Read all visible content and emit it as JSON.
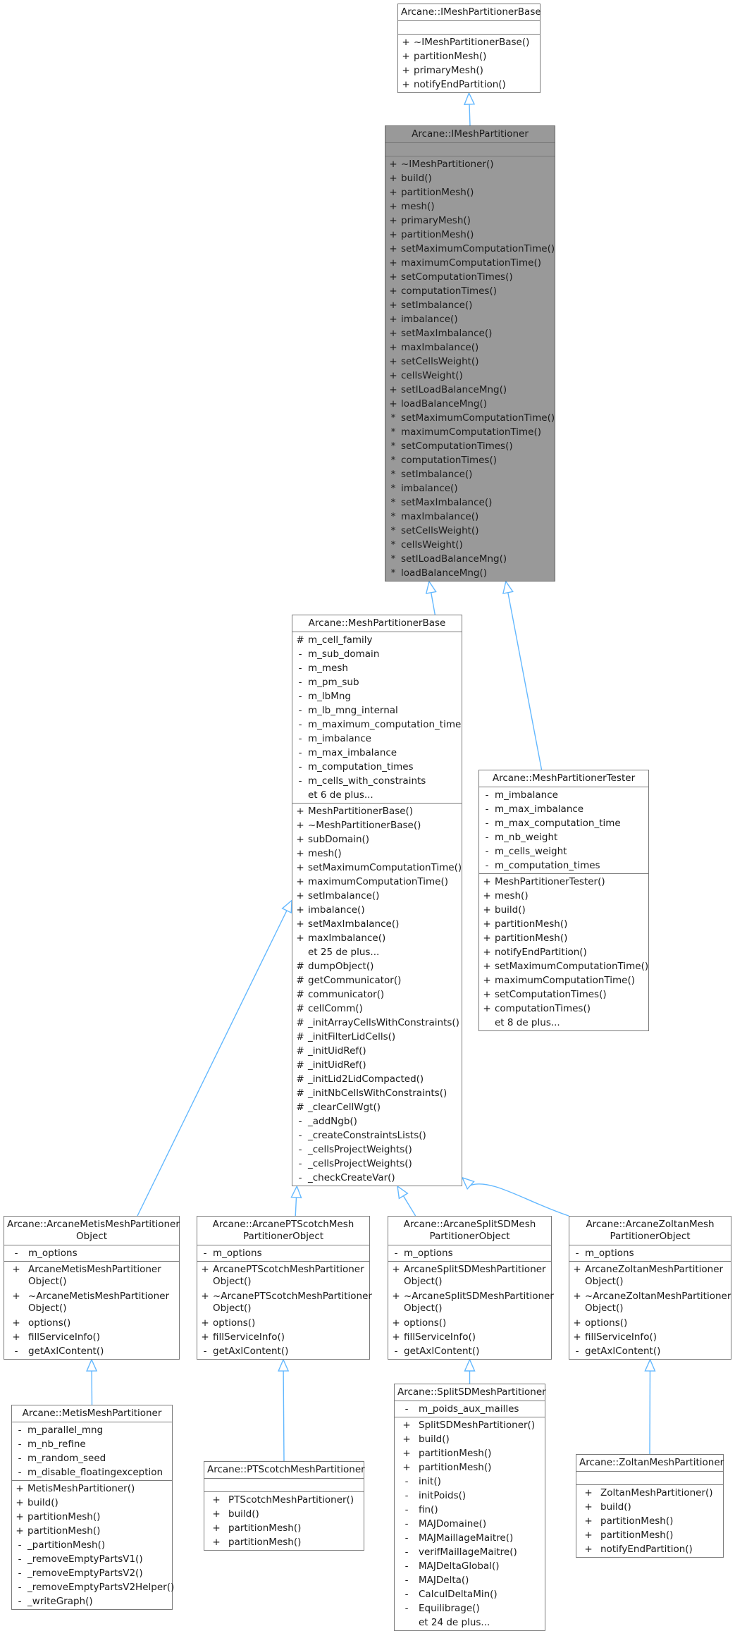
{
  "diagram": {
    "edge_color": "#63b8ff",
    "highlight_fill": "#999999",
    "nodes": [
      {
        "id": "IMeshPartitionerBase",
        "title": "Arcane::IMeshPartitionerBase",
        "attributes": [],
        "methods": [
          {
            "vis": "+",
            "name": "~IMeshPartitionerBase()"
          },
          {
            "vis": "+",
            "name": "partitionMesh()"
          },
          {
            "vis": "+",
            "name": "primaryMesh()"
          },
          {
            "vis": "+",
            "name": "notifyEndPartition()"
          }
        ]
      },
      {
        "id": "IMeshPartitioner",
        "title": "Arcane::IMeshPartitioner",
        "highlighted": true,
        "attributes": [],
        "methods": [
          {
            "vis": "+",
            "name": "~IMeshPartitioner()"
          },
          {
            "vis": "+",
            "name": "build()"
          },
          {
            "vis": "+",
            "name": "partitionMesh()"
          },
          {
            "vis": "+",
            "name": "mesh()"
          },
          {
            "vis": "+",
            "name": "primaryMesh()"
          },
          {
            "vis": "+",
            "name": "partitionMesh()"
          },
          {
            "vis": "+",
            "name": "setMaximumComputationTime()"
          },
          {
            "vis": "+",
            "name": "maximumComputationTime()"
          },
          {
            "vis": "+",
            "name": "setComputationTimes()"
          },
          {
            "vis": "+",
            "name": "computationTimes()"
          },
          {
            "vis": "+",
            "name": "setImbalance()"
          },
          {
            "vis": "+",
            "name": "imbalance()"
          },
          {
            "vis": "+",
            "name": "setMaxImbalance()"
          },
          {
            "vis": "+",
            "name": "maxImbalance()"
          },
          {
            "vis": "+",
            "name": "setCellsWeight()"
          },
          {
            "vis": "+",
            "name": "cellsWeight()"
          },
          {
            "vis": "+",
            "name": "setILoadBalanceMng()"
          },
          {
            "vis": "+",
            "name": "loadBalanceMng()"
          },
          {
            "vis": "*",
            "name": "setMaximumComputationTime()"
          },
          {
            "vis": "*",
            "name": "maximumComputationTime()"
          },
          {
            "vis": "*",
            "name": "setComputationTimes()"
          },
          {
            "vis": "*",
            "name": "computationTimes()"
          },
          {
            "vis": "*",
            "name": "setImbalance()"
          },
          {
            "vis": "*",
            "name": "imbalance()"
          },
          {
            "vis": "*",
            "name": "setMaxImbalance()"
          },
          {
            "vis": "*",
            "name": "maxImbalance()"
          },
          {
            "vis": "*",
            "name": "setCellsWeight()"
          },
          {
            "vis": "*",
            "name": "cellsWeight()"
          },
          {
            "vis": "*",
            "name": "setILoadBalanceMng()"
          },
          {
            "vis": "*",
            "name": "loadBalanceMng()"
          }
        ]
      },
      {
        "id": "MeshPartitionerBase",
        "title": "Arcane::MeshPartitionerBase",
        "attributes": [
          {
            "vis": "#",
            "name": "m_cell_family"
          },
          {
            "vis": "-",
            "name": "m_sub_domain"
          },
          {
            "vis": "-",
            "name": "m_mesh"
          },
          {
            "vis": "-",
            "name": "m_pm_sub"
          },
          {
            "vis": "-",
            "name": "m_lbMng"
          },
          {
            "vis": "-",
            "name": "m_lb_mng_internal"
          },
          {
            "vis": "-",
            "name": "m_maximum_computation_time"
          },
          {
            "vis": "-",
            "name": "m_imbalance"
          },
          {
            "vis": "-",
            "name": "m_max_imbalance"
          },
          {
            "vis": "-",
            "name": "m_computation_times"
          },
          {
            "vis": "-",
            "name": "m_cells_with_constraints"
          },
          {
            "vis": "",
            "name": "et 6 de plus..."
          }
        ],
        "methods": [
          {
            "vis": "+",
            "name": "MeshPartitionerBase()"
          },
          {
            "vis": "+",
            "name": "~MeshPartitionerBase()"
          },
          {
            "vis": "+",
            "name": "subDomain()"
          },
          {
            "vis": "+",
            "name": "mesh()"
          },
          {
            "vis": "+",
            "name": "setMaximumComputationTime()"
          },
          {
            "vis": "+",
            "name": "maximumComputationTime()"
          },
          {
            "vis": "+",
            "name": "setImbalance()"
          },
          {
            "vis": "+",
            "name": "imbalance()"
          },
          {
            "vis": "+",
            "name": "setMaxImbalance()"
          },
          {
            "vis": "+",
            "name": "maxImbalance()"
          },
          {
            "vis": "",
            "name": "et 25 de plus..."
          },
          {
            "vis": "#",
            "name": "dumpObject()"
          },
          {
            "vis": "#",
            "name": "getCommunicator()"
          },
          {
            "vis": "#",
            "name": "communicator()"
          },
          {
            "vis": "#",
            "name": "cellComm()"
          },
          {
            "vis": "#",
            "name": "_initArrayCellsWithConstraints()"
          },
          {
            "vis": "#",
            "name": "_initFilterLidCells()"
          },
          {
            "vis": "#",
            "name": "_initUidRef()"
          },
          {
            "vis": "#",
            "name": "_initUidRef()"
          },
          {
            "vis": "#",
            "name": "_initLid2LidCompacted()"
          },
          {
            "vis": "#",
            "name": "_initNbCellsWithConstraints()"
          },
          {
            "vis": "#",
            "name": "_clearCellWgt()"
          },
          {
            "vis": "-",
            "name": "_addNgb()"
          },
          {
            "vis": "-",
            "name": "_createConstraintsLists()"
          },
          {
            "vis": "-",
            "name": "_cellsProjectWeights()"
          },
          {
            "vis": "-",
            "name": "_cellsProjectWeights()"
          },
          {
            "vis": "-",
            "name": "_checkCreateVar()"
          }
        ]
      },
      {
        "id": "MeshPartitionerTester",
        "title": "Arcane::MeshPartitionerTester",
        "attributes": [
          {
            "vis": "-",
            "name": "m_imbalance"
          },
          {
            "vis": "-",
            "name": "m_max_imbalance"
          },
          {
            "vis": "-",
            "name": "m_max_computation_time"
          },
          {
            "vis": "-",
            "name": "m_nb_weight"
          },
          {
            "vis": "-",
            "name": "m_cells_weight"
          },
          {
            "vis": "-",
            "name": "m_computation_times"
          }
        ],
        "methods": [
          {
            "vis": "+",
            "name": "MeshPartitionerTester()"
          },
          {
            "vis": "+",
            "name": "mesh()"
          },
          {
            "vis": "+",
            "name": "build()"
          },
          {
            "vis": "+",
            "name": "partitionMesh()"
          },
          {
            "vis": "+",
            "name": "partitionMesh()"
          },
          {
            "vis": "+",
            "name": "notifyEndPartition()"
          },
          {
            "vis": "+",
            "name": "setMaximumComputationTime()"
          },
          {
            "vis": "+",
            "name": "maximumComputationTime()"
          },
          {
            "vis": "+",
            "name": "setComputationTimes()"
          },
          {
            "vis": "+",
            "name": "computationTimes()"
          },
          {
            "vis": "",
            "name": "et 8 de plus..."
          }
        ]
      },
      {
        "id": "ArcaneMetisMeshPartitionerObject",
        "title": "Arcane::ArcaneMetisMeshPartitioner\nObject",
        "attributes": [
          {
            "vis": "-",
            "name": "m_options"
          }
        ],
        "methods": [
          {
            "vis": "+",
            "name": "ArcaneMetisMeshPartitioner\nObject()"
          },
          {
            "vis": "+",
            "name": "~ArcaneMetisMeshPartitioner\nObject()"
          },
          {
            "vis": "+",
            "name": "options()"
          },
          {
            "vis": "+",
            "name": "fillServiceInfo()"
          },
          {
            "vis": "-",
            "name": "getAxlContent()"
          }
        ]
      },
      {
        "id": "ArcanePTScotchMeshPartitionerObject",
        "title": "Arcane::ArcanePTScotchMesh\nPartitionerObject",
        "attributes": [
          {
            "vis": "-",
            "name": "m_options"
          }
        ],
        "methods": [
          {
            "vis": "+",
            "name": "ArcanePTScotchMeshPartitioner\nObject()"
          },
          {
            "vis": "+",
            "name": "~ArcanePTScotchMeshPartitioner\nObject()"
          },
          {
            "vis": "+",
            "name": "options()"
          },
          {
            "vis": "+",
            "name": "fillServiceInfo()"
          },
          {
            "vis": "-",
            "name": "getAxlContent()"
          }
        ]
      },
      {
        "id": "ArcaneSplitSDMeshPartitionerObject",
        "title": "Arcane::ArcaneSplitSDMesh\nPartitionerObject",
        "attributes": [
          {
            "vis": "-",
            "name": "m_options"
          }
        ],
        "methods": [
          {
            "vis": "+",
            "name": "ArcaneSplitSDMeshPartitioner\nObject()"
          },
          {
            "vis": "+",
            "name": "~ArcaneSplitSDMeshPartitioner\nObject()"
          },
          {
            "vis": "+",
            "name": "options()"
          },
          {
            "vis": "+",
            "name": "fillServiceInfo()"
          },
          {
            "vis": "-",
            "name": "getAxlContent()"
          }
        ]
      },
      {
        "id": "ArcaneZoltanMeshPartitionerObject",
        "title": "Arcane::ArcaneZoltanMesh\nPartitionerObject",
        "attributes": [
          {
            "vis": "-",
            "name": "m_options"
          }
        ],
        "methods": [
          {
            "vis": "+",
            "name": "ArcaneZoltanMeshPartitioner\nObject()"
          },
          {
            "vis": "+",
            "name": "~ArcaneZoltanMeshPartitioner\nObject()"
          },
          {
            "vis": "+",
            "name": "options()"
          },
          {
            "vis": "+",
            "name": "fillServiceInfo()"
          },
          {
            "vis": "-",
            "name": "getAxlContent()"
          }
        ]
      },
      {
        "id": "MetisMeshPartitioner",
        "title": "Arcane::MetisMeshPartitioner",
        "attributes": [
          {
            "vis": "-",
            "name": "m_parallel_mng"
          },
          {
            "vis": "-",
            "name": "m_nb_refine"
          },
          {
            "vis": "-",
            "name": "m_random_seed"
          },
          {
            "vis": "-",
            "name": "m_disable_floatingexception"
          }
        ],
        "methods": [
          {
            "vis": "+",
            "name": "MetisMeshPartitioner()"
          },
          {
            "vis": "+",
            "name": "build()"
          },
          {
            "vis": "+",
            "name": "partitionMesh()"
          },
          {
            "vis": "+",
            "name": "partitionMesh()"
          },
          {
            "vis": "-",
            "name": "_partitionMesh()"
          },
          {
            "vis": "-",
            "name": "_removeEmptyPartsV1()"
          },
          {
            "vis": "-",
            "name": "_removeEmptyPartsV2()"
          },
          {
            "vis": "-",
            "name": "_removeEmptyPartsV2Helper()"
          },
          {
            "vis": "-",
            "name": "_writeGraph()"
          }
        ]
      },
      {
        "id": "PTScotchMeshPartitioner",
        "title": "Arcane::PTScotchMeshPartitioner",
        "attributes": [],
        "methods": [
          {
            "vis": "+",
            "name": "PTScotchMeshPartitioner()"
          },
          {
            "vis": "+",
            "name": "build()"
          },
          {
            "vis": "+",
            "name": "partitionMesh()"
          },
          {
            "vis": "+",
            "name": "partitionMesh()"
          }
        ]
      },
      {
        "id": "SplitSDMeshPartitioner",
        "title": "Arcane::SplitSDMeshPartitioner",
        "attributes": [
          {
            "vis": "-",
            "name": "m_poids_aux_mailles"
          }
        ],
        "methods": [
          {
            "vis": "+",
            "name": "SplitSDMeshPartitioner()"
          },
          {
            "vis": "+",
            "name": "build()"
          },
          {
            "vis": "+",
            "name": "partitionMesh()"
          },
          {
            "vis": "+",
            "name": "partitionMesh()"
          },
          {
            "vis": "-",
            "name": "init()"
          },
          {
            "vis": "-",
            "name": "initPoids()"
          },
          {
            "vis": "-",
            "name": "fin()"
          },
          {
            "vis": "-",
            "name": "MAJDomaine()"
          },
          {
            "vis": "-",
            "name": "MAJMaillageMaitre()"
          },
          {
            "vis": "-",
            "name": "verifMaillageMaitre()"
          },
          {
            "vis": "-",
            "name": "MAJDeltaGlobal()"
          },
          {
            "vis": "-",
            "name": "MAJDelta()"
          },
          {
            "vis": "-",
            "name": "CalculDeltaMin()"
          },
          {
            "vis": "-",
            "name": "Equilibrage()"
          },
          {
            "vis": "",
            "name": "et 24 de plus..."
          }
        ]
      },
      {
        "id": "ZoltanMeshPartitioner",
        "title": "Arcane::ZoltanMeshPartitioner",
        "attributes": [],
        "methods": [
          {
            "vis": "+",
            "name": "ZoltanMeshPartitioner()"
          },
          {
            "vis": "+",
            "name": "build()"
          },
          {
            "vis": "+",
            "name": "partitionMesh()"
          },
          {
            "vis": "+",
            "name": "partitionMesh()"
          },
          {
            "vis": "+",
            "name": "notifyEndPartition()"
          }
        ]
      }
    ],
    "edges": [
      {
        "from": "IMeshPartitioner",
        "to": "IMeshPartitionerBase",
        "type": "inheritance"
      },
      {
        "from": "MeshPartitionerBase",
        "to": "IMeshPartitioner",
        "type": "inheritance"
      },
      {
        "from": "MeshPartitionerTester",
        "to": "IMeshPartitioner",
        "type": "inheritance"
      },
      {
        "from": "ArcaneMetisMeshPartitionerObject",
        "to": "MeshPartitionerBase",
        "type": "inheritance"
      },
      {
        "from": "ArcanePTScotchMeshPartitionerObject",
        "to": "MeshPartitionerBase",
        "type": "inheritance"
      },
      {
        "from": "ArcaneSplitSDMeshPartitionerObject",
        "to": "MeshPartitionerBase",
        "type": "inheritance"
      },
      {
        "from": "ArcaneZoltanMeshPartitionerObject",
        "to": "MeshPartitionerBase",
        "type": "inheritance"
      },
      {
        "from": "MetisMeshPartitioner",
        "to": "ArcaneMetisMeshPartitionerObject",
        "type": "inheritance"
      },
      {
        "from": "PTScotchMeshPartitioner",
        "to": "ArcanePTScotchMeshPartitionerObject",
        "type": "inheritance"
      },
      {
        "from": "SplitSDMeshPartitioner",
        "to": "ArcaneSplitSDMeshPartitionerObject",
        "type": "inheritance"
      },
      {
        "from": "ZoltanMeshPartitioner",
        "to": "ArcaneZoltanMeshPartitionerObject",
        "type": "inheritance"
      }
    ]
  }
}
